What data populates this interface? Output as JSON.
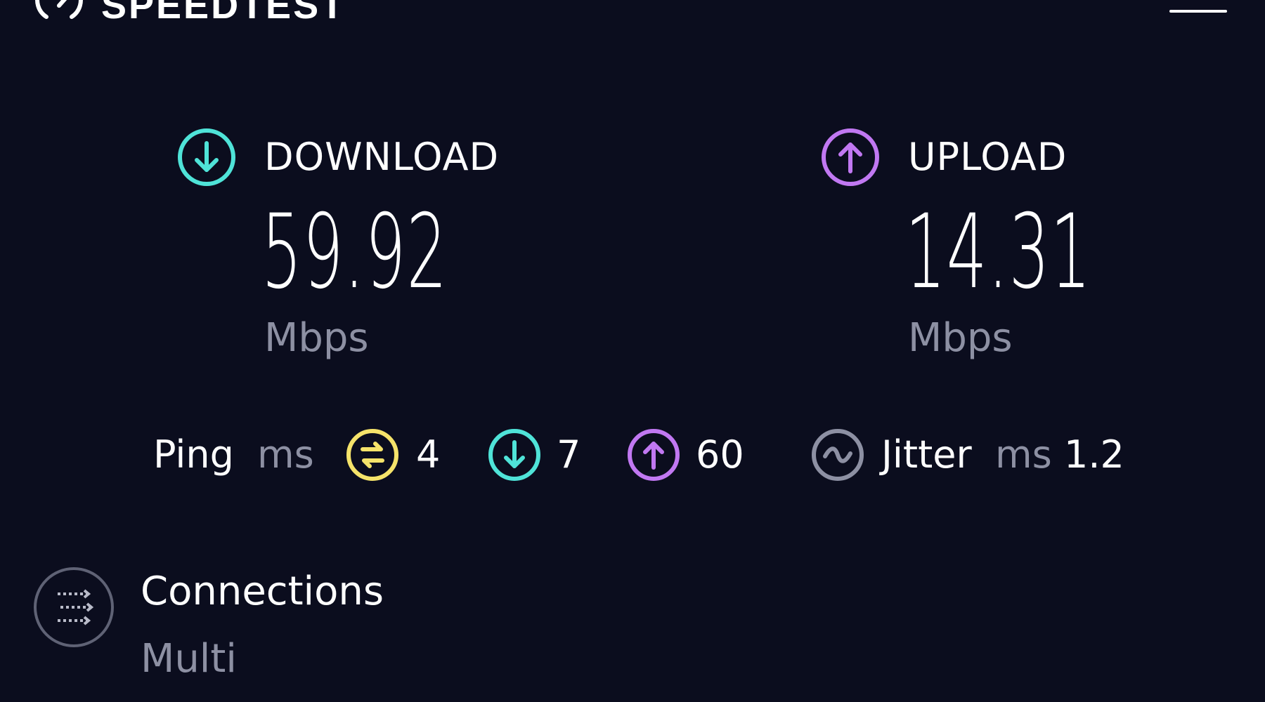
{
  "header": {
    "logo_text": "SPEEDTEST",
    "logo_icon": "speedometer-icon",
    "menu_icon": "hamburger-menu-icon"
  },
  "download": {
    "label": "DOWNLOAD",
    "value": "59.92",
    "unit": "Mbps",
    "icon": "download-arrow-icon",
    "color": "#4fe3d8"
  },
  "upload": {
    "label": "UPLOAD",
    "value": "14.31",
    "unit": "Mbps",
    "icon": "upload-arrow-icon",
    "color": "#c178f2"
  },
  "ping": {
    "label": "Ping",
    "unit": "ms",
    "idle_value": "4",
    "idle_icon": "idle-latency-icon",
    "idle_color": "#f5e36a",
    "download_value": "7",
    "download_icon": "download-latency-icon",
    "upload_value": "60",
    "upload_icon": "upload-latency-icon"
  },
  "jitter": {
    "label": "Jitter",
    "unit": "ms",
    "value": "1.2",
    "icon": "jitter-wave-icon",
    "color": "#8d90a3"
  },
  "connections": {
    "title": "Connections",
    "value": "Multi",
    "icon": "multi-connection-icon"
  }
}
